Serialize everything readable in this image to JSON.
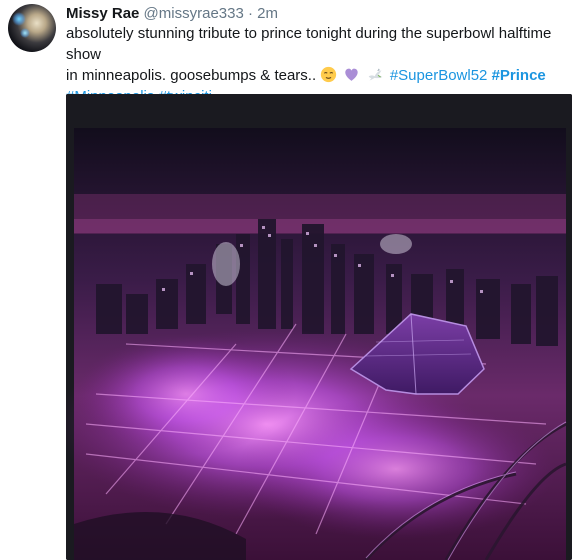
{
  "tweet": {
    "display_name": "Missy Rae",
    "handle": "@missyrae333",
    "separator": "·",
    "time": "2m",
    "text_line1": "absolutely stunning tribute to prince tonight during the superbowl halftime show",
    "text_line2_prefix": "in minneapolis. goosebumps & tears..",
    "hashtags": {
      "superbowl": "#SuperBowl52",
      "prince": "#Prince",
      "minneapolis": "#Minneapolis",
      "twinciti": "#twinciti"
    },
    "emojis": [
      "relieved-face",
      "purple-heart",
      "dove"
    ]
  },
  "colors": {
    "link": "#1b95e0",
    "text": "#14171a",
    "meta": "#657786",
    "purple_light": "#d35cff"
  }
}
